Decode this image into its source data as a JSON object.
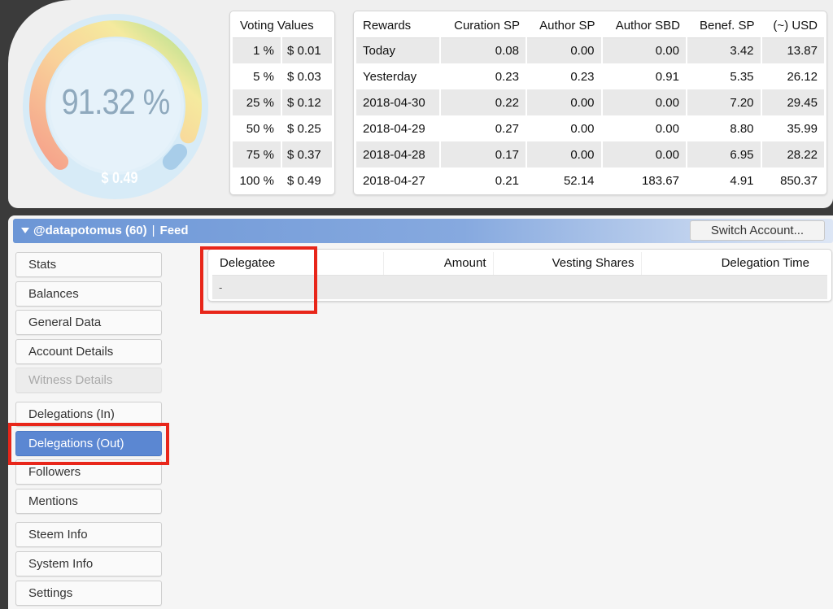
{
  "gauge": {
    "percent": "91.32 %",
    "vote_value": "$ 0.49",
    "level": 0.9132,
    "colors": {
      "ring_start": "#f5a08a",
      "ring_mid": "#f7e39a",
      "ring_end": "#a9dc8c",
      "inner": "#d7ebf7",
      "tail": "#9cc6e6"
    }
  },
  "voting": {
    "header": "Voting Values",
    "rows": [
      {
        "pct": "1 %",
        "value": "$ 0.01"
      },
      {
        "pct": "5 %",
        "value": "$ 0.03"
      },
      {
        "pct": "25 %",
        "value": "$ 0.12"
      },
      {
        "pct": "50 %",
        "value": "$ 0.25"
      },
      {
        "pct": "75 %",
        "value": "$ 0.37"
      },
      {
        "pct": "100 %",
        "value": "$ 0.49"
      }
    ]
  },
  "rewards": {
    "headers": [
      "Rewards",
      "Curation SP",
      "Author SP",
      "Author SBD",
      "Benef. SP",
      "(~) USD"
    ],
    "rows": [
      [
        "Today",
        "0.08",
        "0.00",
        "0.00",
        "3.42",
        "13.87"
      ],
      [
        "Yesterday",
        "0.23",
        "0.23",
        "0.91",
        "5.35",
        "26.12"
      ],
      [
        "2018-04-30",
        "0.22",
        "0.00",
        "0.00",
        "7.20",
        "29.45"
      ],
      [
        "2018-04-29",
        "0.27",
        "0.00",
        "0.00",
        "8.80",
        "35.99"
      ],
      [
        "2018-04-28",
        "0.17",
        "0.00",
        "0.00",
        "6.95",
        "28.22"
      ],
      [
        "2018-04-27",
        "0.21",
        "52.14",
        "183.67",
        "4.91",
        "850.37"
      ]
    ]
  },
  "account_bar": {
    "account": "@datapotomus (60)",
    "separator": "|",
    "feed": "Feed",
    "switch_label": "Switch Account..."
  },
  "nav": {
    "items": [
      {
        "label": "Stats",
        "state": "normal"
      },
      {
        "label": "Balances",
        "state": "normal"
      },
      {
        "label": "General Data",
        "state": "normal"
      },
      {
        "label": "Account Details",
        "state": "normal"
      },
      {
        "label": "Witness Details",
        "state": "disabled"
      },
      {
        "label": "Delegations (In)",
        "state": "normal"
      },
      {
        "label": "Delegations (Out)",
        "state": "active"
      },
      {
        "label": "Followers",
        "state": "normal"
      },
      {
        "label": "Mentions",
        "state": "normal"
      },
      {
        "label": "Steem Info",
        "state": "normal"
      },
      {
        "label": "System Info",
        "state": "normal"
      },
      {
        "label": "Settings",
        "state": "normal"
      }
    ]
  },
  "delegations": {
    "headers": {
      "delegatee": "Delegatee",
      "amount": "Amount",
      "vesting": "Vesting Shares",
      "time": "Delegation Time"
    },
    "empty_row": "-"
  },
  "highlight_color": "#e8261a",
  "accent_color": "#5b87d2"
}
